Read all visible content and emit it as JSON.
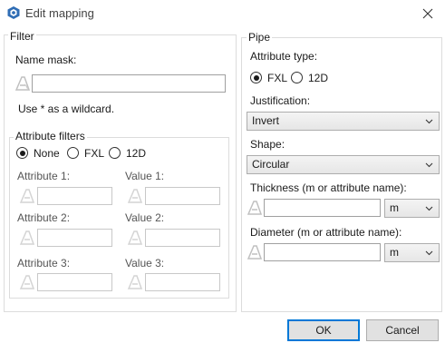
{
  "window": {
    "title": "Edit mapping",
    "icon": "app-logo-icon"
  },
  "filter": {
    "group_title": "Filter",
    "name_mask_label": "Name mask:",
    "name_mask_value": "",
    "wildcard_hint": "Use * as a wildcard.",
    "attribute_filters": {
      "group_title": "Attribute filters",
      "options": [
        "None",
        "FXL",
        "12D"
      ],
      "selected": "None",
      "rows": [
        {
          "attribute_label": "Attribute 1:",
          "value_label": "Value 1:",
          "attribute": "",
          "value": ""
        },
        {
          "attribute_label": "Attribute 2:",
          "value_label": "Value 2:",
          "attribute": "",
          "value": ""
        },
        {
          "attribute_label": "Attribute 3:",
          "value_label": "Value 3:",
          "attribute": "",
          "value": ""
        }
      ]
    }
  },
  "pipe": {
    "group_title": "Pipe",
    "attribute_type_label": "Attribute type:",
    "attribute_type_options": [
      "FXL",
      "12D"
    ],
    "attribute_type_selected": "FXL",
    "justification_label": "Justification:",
    "justification_value": "Invert",
    "shape_label": "Shape:",
    "shape_value": "Circular",
    "thickness_label": "Thickness (m or attribute name):",
    "thickness_value": "",
    "thickness_unit": "m",
    "diameter_label": "Diameter (m or attribute name):",
    "diameter_value": "",
    "diameter_unit": "m"
  },
  "footer": {
    "ok_label": "OK",
    "cancel_label": "Cancel"
  },
  "colors": {
    "accent": "#0078d7",
    "icon_gray": "#c0c0c0",
    "border": "#dcdcdc"
  }
}
